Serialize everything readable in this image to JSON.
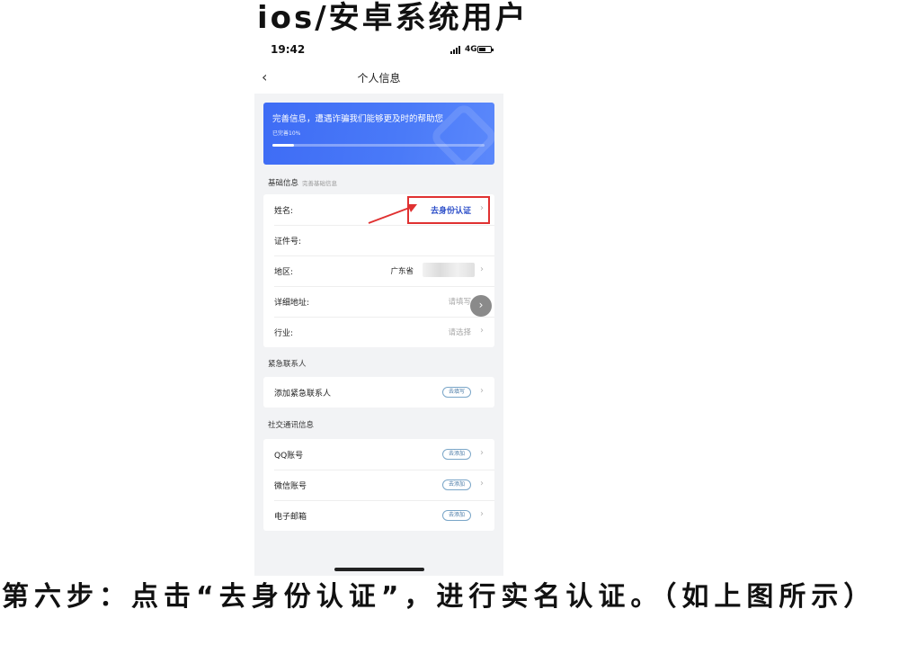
{
  "captions": {
    "top": "ios/安卓系统用户",
    "bottom": "第六步：点击“去身份认证”，进行实名认证。（如上图所示）"
  },
  "status_bar": {
    "time": "19:42",
    "network": "4G"
  },
  "nav": {
    "title": "个人信息"
  },
  "banner": {
    "title": "完善信息，遭遇诈骗我们能够更及时的帮助您",
    "progress_text": "已完善10%",
    "progress": 0.1
  },
  "basic_info": {
    "title": "基础信息",
    "subtitle": "完善基础信息",
    "rows": [
      {
        "label": "姓名:",
        "value": "去身份认证"
      },
      {
        "label": "证件号:",
        "value": ""
      },
      {
        "label": "地区:",
        "value": "广东省"
      },
      {
        "label": "详细地址:",
        "placeholder": "请填写"
      },
      {
        "label": "行业:",
        "placeholder": "请选择"
      }
    ]
  },
  "emergency": {
    "title": "紧急联系人",
    "rows": [
      {
        "label": "添加紧急联系人",
        "pill": "去填写"
      }
    ]
  },
  "social": {
    "title": "社交通讯信息",
    "rows": [
      {
        "label": "QQ账号",
        "pill": "去添加"
      },
      {
        "label": "微信账号",
        "pill": "去添加"
      },
      {
        "label": "电子邮箱",
        "pill": "去添加"
      }
    ]
  },
  "icons": {
    "back": "chevron-left-icon",
    "row_chevron": "chevron-right-icon",
    "float": "chevron-right-icon"
  },
  "colors": {
    "accent": "#3e6cf5",
    "highlight": "#e03131",
    "verify_text": "#2d4fc9"
  }
}
